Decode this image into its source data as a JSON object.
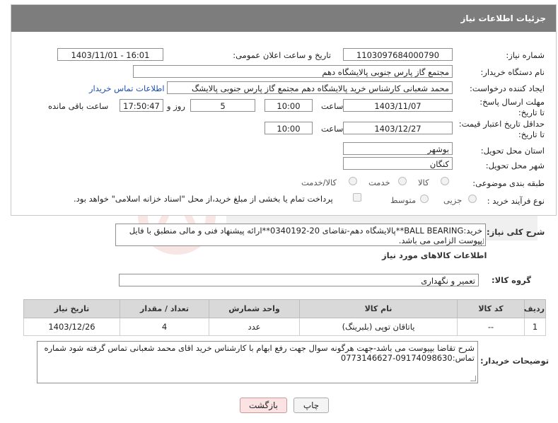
{
  "header": {
    "title": "جزئیات اطلاعات نیاز"
  },
  "fields": {
    "need_number_label": "شماره نیاز:",
    "need_number": "1103097684000790",
    "announce_label": "تاریخ و ساعت اعلان عمومی:",
    "announce_value": "1403/11/01 - 16:01",
    "buyer_org_label": "نام دستگاه خریدار:",
    "buyer_org": "مجتمع گاز پارس جنوبی  پالایشگاه دهم",
    "requester_label": "ایجاد کننده درخواست:",
    "requester": "محمد شعبانی کارشناس خرید پالایشگاه دهم  مجتمع گاز پارس جنوبی  پالایشگ",
    "buyer_contact_link": "اطلاعات تماس خریدار",
    "deadline_label": "مهلت ارسال پاسخ: تا تاریخ:",
    "deadline_date": "1403/11/07",
    "time_label": "ساعت",
    "deadline_time": "10:00",
    "days_value": "5",
    "days_label": "روز و",
    "remaining_time": "17:50:47",
    "remaining_label": "ساعت باقی مانده",
    "validity_label": "حداقل تاریخ اعتبار قیمت: تا تاریخ:",
    "validity_date": "1403/12/27",
    "validity_time": "10:00",
    "province_label": "استان محل تحویل:",
    "province": "بوشهر",
    "city_label": "شهر محل تحویل:",
    "city": "کنگان",
    "category_label": "طبقه بندی موضوعی:",
    "category_options": [
      "کالا",
      "خدمت",
      "کالا/خدمت"
    ],
    "process_label": "نوع فرآیند خرید :",
    "process_options": [
      "جزیی",
      "متوسط"
    ],
    "treasury_note": "پرداخت تمام یا بخشی از مبلغ خرید،از محل \"اسناد خزانه اسلامی\" خواهد بود."
  },
  "summary": {
    "label": "شرح کلی نیاز:",
    "text": "خرید:BALL BEARING**پالایشگاه دهم-تقاضای 20-0340192**ارائه پیشنهاد فنی و مالی منطبق با فایل پیوست الزامی می باشد."
  },
  "goods_info_title": "اطلاعات کالاهای مورد نیاز",
  "goods_group": {
    "label": "گروه کالا:",
    "value": "تعمیر و نگهداری"
  },
  "table": {
    "headers": [
      "ردیف",
      "کد کالا",
      "نام کالا",
      "واحد شمارش",
      "تعداد / مقدار",
      "تاریخ نیاز"
    ],
    "rows": [
      [
        "1",
        "--",
        "یاتاقان توپی (بلبرینگ)",
        "عدد",
        "4",
        "1403/12/26"
      ]
    ]
  },
  "buyer_notes": {
    "label": "توضیحات خریدار:",
    "text": "شرح تقاضا بپیوست می باشد-جهت هرگونه سوال جهت رفع ابهام با کارشناس خرید اقای محمد شعبانی تماس گرفته شود شماره تماس:09174098630-0773146627"
  },
  "buttons": {
    "print": "چاپ",
    "back": "بازگشت"
  },
  "colors": {
    "header_bg": "#7d7d7d",
    "link": "#1a4fb3",
    "back_bg": "#fbe3e3"
  }
}
